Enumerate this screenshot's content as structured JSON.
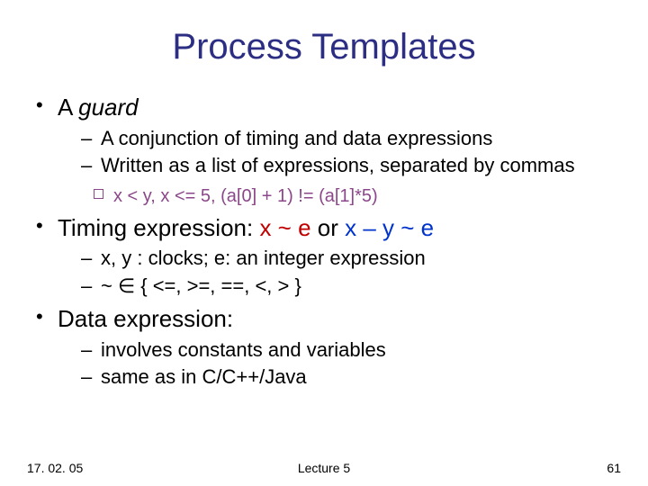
{
  "title": "Process Templates",
  "bullets": {
    "guard": {
      "label_pre": "A ",
      "label_it": "guard",
      "sub1": "A conjunction of timing and data expressions",
      "sub2": "Written as a list of expressions, separated by commas",
      "example": "x < y, x <= 5, (a[0] + 1) != (a[1]*5)"
    },
    "timing": {
      "label": "Timing expression:  ",
      "expr1": "x ~ e",
      "or": " or ",
      "expr2": "x – y ~ e",
      "sub1_pre": "x, y",
      "sub1_mid": " : clocks; ",
      "sub1_e": "e",
      "sub1_rest": ": an integer expression",
      "sub2": "~  ∈ { <=, >=, ==, <, > }"
    },
    "dataexpr": {
      "label": "Data expression:",
      "sub1": "involves constants and variables",
      "sub2": "same as in C/C++/Java"
    }
  },
  "footer": {
    "date": "17. 02. 05",
    "lecture": "Lecture 5",
    "page": "61"
  }
}
